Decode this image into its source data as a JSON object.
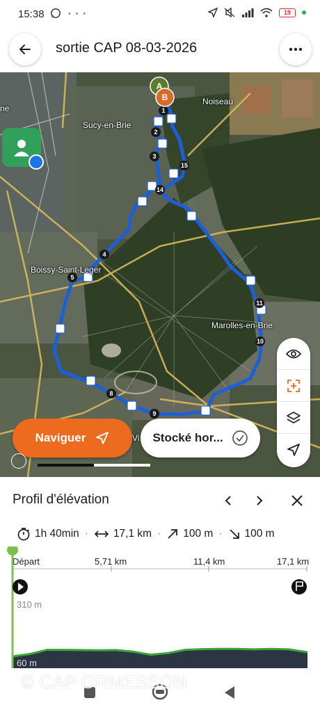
{
  "status": {
    "time": "15:38",
    "battery": "19",
    "left_icons": [
      "whatsapp-icon",
      "more-dots-icon"
    ],
    "right_icons": [
      "location-arrow-icon",
      "mute-icon",
      "signal-icon",
      "wifi-icon",
      "battery-icon"
    ]
  },
  "header": {
    "title": "sortie CAP 08-03-2026"
  },
  "map": {
    "places": {
      "noiseau": "Noiseau",
      "sucy": "Sucy-en-Brie",
      "boissy": "Boissy-Saint-Leger",
      "marolles": "Marolles-en-Brie",
      "edge_left": "ne",
      "edge_bottom": "Vi"
    },
    "start_marker": "A",
    "end_marker": "B",
    "km_markers": [
      "1",
      "2",
      "3",
      "4",
      "5",
      "8",
      "9",
      "10",
      "11",
      "14",
      "15"
    ],
    "route_color": "#1d5fd6",
    "navigate_label": "Naviguer",
    "stored_label": "Stocké hor..."
  },
  "elevation": {
    "title": "Profil d'élévation",
    "duration": "1h 40min",
    "distance": "17,1 km",
    "ascent": "100 m",
    "descent": "100 m",
    "distance_ticks": [
      "Départ",
      "5,71 km",
      "11,4 km",
      "17,1 km"
    ],
    "y_max_label": "310 m",
    "y_min_label": "60 m",
    "profile_color": "#3aa635",
    "profile_km": [
      0,
      1,
      2,
      3,
      4,
      5,
      6,
      7,
      8,
      9,
      10,
      11,
      12,
      13,
      14,
      15,
      16,
      17.1
    ],
    "profile_m": [
      60,
      70,
      88,
      88,
      87,
      86,
      87,
      80,
      67,
      74,
      88,
      91,
      92,
      92,
      90,
      92,
      90,
      78
    ],
    "watermark": "© CAP ORMESSON"
  }
}
